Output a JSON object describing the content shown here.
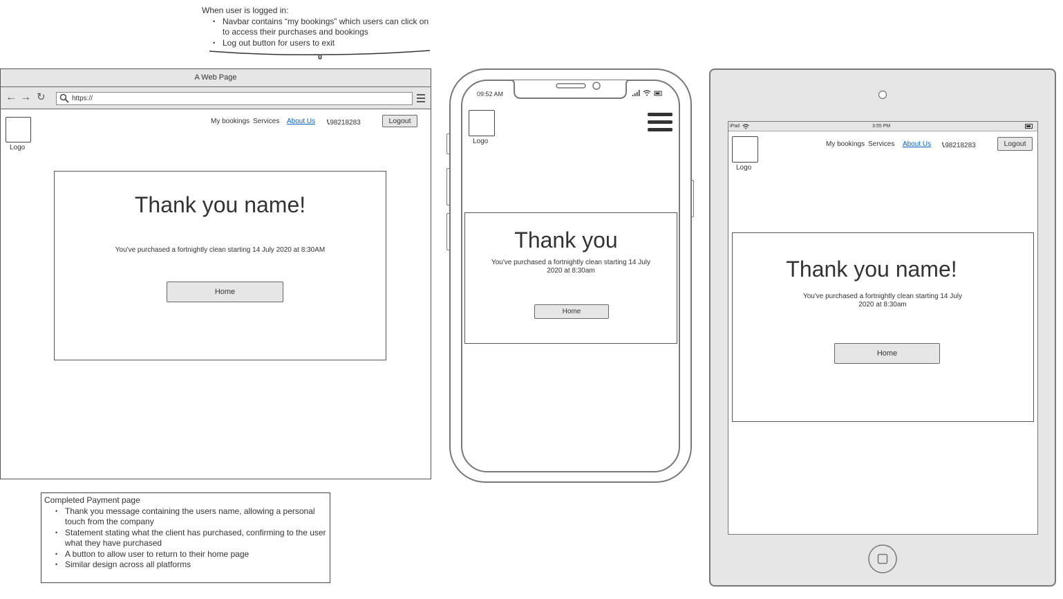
{
  "annotation_top": {
    "heading": "When user is logged in:",
    "items": [
      "Navbar contains “my bookings” which users can click on to access their purchases and bookings",
      "Log out button for users to exit"
    ]
  },
  "annotation_bottom": {
    "heading": "Completed Payment page",
    "items": [
      "Thank you message containing the users name, allowing a personal touch from the company",
      "Statement stating what the client has purchased, confirming to the user what they have purchased",
      "A button to allow user to return to their home page",
      "Similar design across all platforms"
    ]
  },
  "browser": {
    "window_title": "A Web Page",
    "url": "https://",
    "logo_label": "Logo",
    "nav": {
      "my_bookings": "My bookings",
      "services": "Services",
      "about_us": "About Us",
      "phone": "98218283",
      "logout": "Logout"
    },
    "thank_you": "Thank you name!",
    "message": "You've purchased a fortnightly clean starting 14 July 2020 at 8:30AM",
    "home_button": "Home"
  },
  "phone": {
    "time": "09:52 AM",
    "logo_label": "Logo",
    "thank_you": "Thank you",
    "message": "You've purchased a fortnightly clean starting 14 July 2020 at 8:30am",
    "home_button": "Home"
  },
  "tablet": {
    "device_label": "iPad",
    "time": "3:55 PM",
    "logo_label": "Logo",
    "nav": {
      "my_bookings": "My bookings",
      "services": "Services",
      "about_us": "About Us",
      "phone": "98218283",
      "logout": "Logout"
    },
    "thank_you": "Thank you name!",
    "message": "You've purchased a fortnightly clean starting 14 July 2020 at 8:30am",
    "home_button": "Home"
  }
}
